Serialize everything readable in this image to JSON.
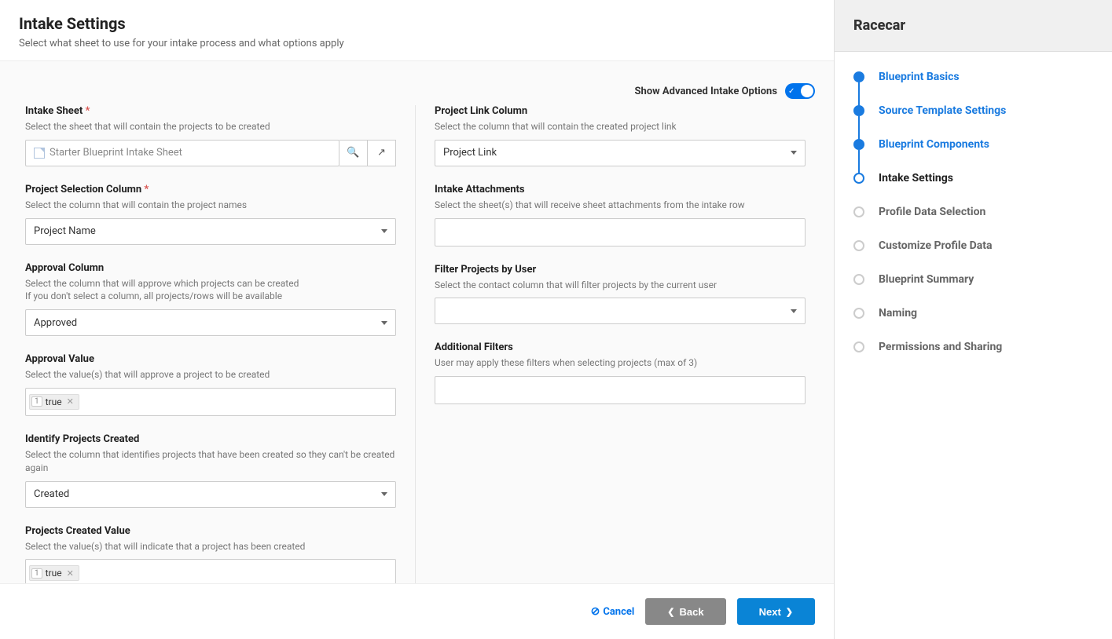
{
  "header": {
    "title": "Intake Settings",
    "subtitle": "Select what sheet to use for your intake process and what options apply"
  },
  "advancedToggle": {
    "label": "Show Advanced Intake Options",
    "on": true
  },
  "left": {
    "intakeSheet": {
      "label": "Intake Sheet",
      "required": true,
      "desc": "Select the sheet that will contain the projects to be created",
      "value": "Starter Blueprint Intake Sheet"
    },
    "projectSelection": {
      "label": "Project Selection Column",
      "required": true,
      "desc": "Select the column that will contain the project names",
      "value": "Project Name"
    },
    "approvalColumn": {
      "label": "Approval Column",
      "desc": "Select the column that will approve which projects can be created",
      "desc2": "If you don't select a column, all projects/rows will be available",
      "value": "Approved"
    },
    "approvalValue": {
      "label": "Approval Value",
      "desc": "Select the value(s) that will approve a project to be created",
      "tags": [
        {
          "num": "1",
          "text": "true"
        }
      ]
    },
    "identifyCreated": {
      "label": "Identify Projects Created",
      "desc": "Select the column that identifies projects that have been created so they can't be created again",
      "value": "Created"
    },
    "createdValue": {
      "label": "Projects Created Value",
      "desc": "Select the value(s) that will indicate that a project has been created",
      "tags": [
        {
          "num": "1",
          "text": "true"
        }
      ]
    }
  },
  "right": {
    "projectLink": {
      "label": "Project Link Column",
      "desc": "Select the column that will contain the created project link",
      "value": "Project Link"
    },
    "intakeAttachments": {
      "label": "Intake Attachments",
      "desc": "Select the sheet(s) that will receive sheet attachments from the intake row"
    },
    "filterByUser": {
      "label": "Filter Projects by User",
      "desc": "Select the contact column that will filter projects by the current user"
    },
    "additionalFilters": {
      "label": "Additional Filters",
      "desc": "User may apply these filters when selecting projects (max of 3)"
    }
  },
  "footer": {
    "cancel": "Cancel",
    "back": "Back",
    "next": "Next"
  },
  "sidebar": {
    "title": "Racecar",
    "steps": [
      {
        "label": "Blueprint Basics",
        "state": "done"
      },
      {
        "label": "Source Template Settings",
        "state": "done"
      },
      {
        "label": "Blueprint Components",
        "state": "done"
      },
      {
        "label": "Intake Settings",
        "state": "current"
      },
      {
        "label": "Profile Data Selection",
        "state": "future"
      },
      {
        "label": "Customize Profile Data",
        "state": "future"
      },
      {
        "label": "Blueprint Summary",
        "state": "future"
      },
      {
        "label": "Naming",
        "state": "future"
      },
      {
        "label": "Permissions and Sharing",
        "state": "future"
      }
    ]
  }
}
